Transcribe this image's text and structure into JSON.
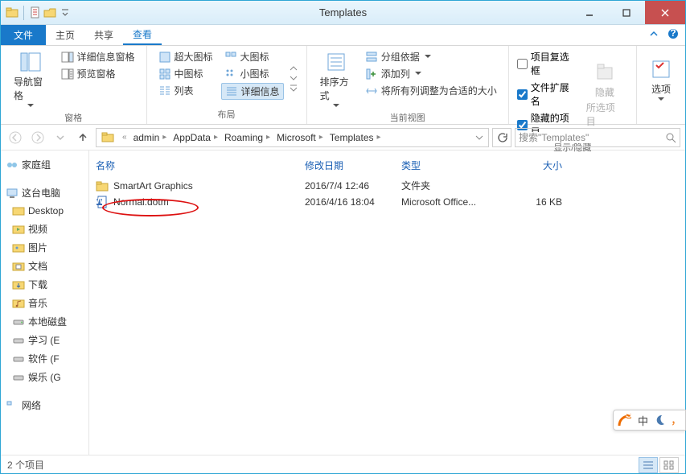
{
  "window": {
    "title": "Templates"
  },
  "tabs": {
    "file": "文件",
    "home": "主页",
    "share": "共享",
    "view": "查看"
  },
  "ribbon": {
    "pane": {
      "nav": "导航窗格",
      "detailsPane": "详细信息窗格",
      "preview": "预览窗格",
      "group": "窗格"
    },
    "layout": {
      "xl": "超大图标",
      "large": "大图标",
      "medium": "中图标",
      "small": "小图标",
      "list": "列表",
      "details": "详细信息",
      "group": "布局"
    },
    "current": {
      "sort": "排序方式",
      "groupBy": "分组依据",
      "addCol": "添加列",
      "fitCols": "将所有列调整为合适的大小",
      "group": "当前视图"
    },
    "showhide": {
      "chkBoxes": "项目复选框",
      "ext": "文件扩展名",
      "hidden": "隐藏的项目",
      "hide": "隐藏",
      "hideSub": "所选项目",
      "group": "显示/隐藏"
    },
    "options": "选项"
  },
  "breadcrumbs": [
    "admin",
    "AppData",
    "Roaming",
    "Microsoft",
    "Templates"
  ],
  "search": {
    "placeholder": "搜索\"Templates\""
  },
  "columns": {
    "name": "名称",
    "date": "修改日期",
    "type": "类型",
    "size": "大小"
  },
  "rows": [
    {
      "name": "SmartArt Graphics",
      "date": "2016/7/4 12:46",
      "type": "文件夹",
      "size": "",
      "kind": "folder"
    },
    {
      "name": "Normal.dotm",
      "date": "2016/4/16 18:04",
      "type": "Microsoft Office...",
      "size": "16 KB",
      "kind": "word"
    }
  ],
  "sidebar": {
    "home": "家庭组",
    "pc": "这台电脑",
    "desktop": "Desktop",
    "videos": "视频",
    "pictures": "图片",
    "docs": "文档",
    "downloads": "下载",
    "music": "音乐",
    "disk": "本地磁盘",
    "study": "学习 (E",
    "soft": "软件 (F",
    "ent": "娱乐 (G",
    "net": "网络"
  },
  "status": {
    "items": "2 个项目"
  },
  "ime": {
    "lang": "中"
  }
}
